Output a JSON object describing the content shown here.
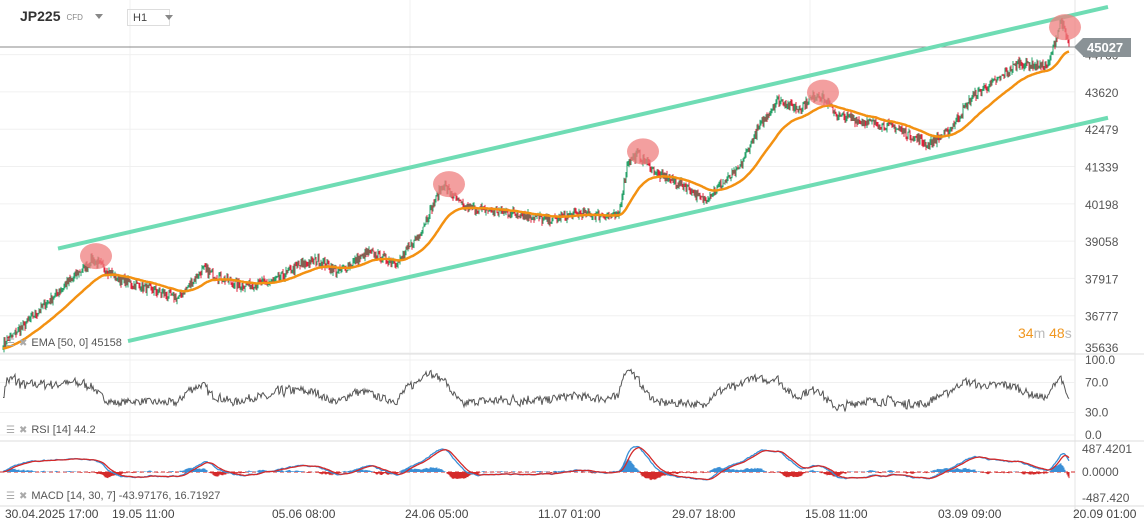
{
  "header": {
    "symbol": "JP225",
    "symbol_type": "CFD",
    "timeframe": "H1"
  },
  "current_price_label": "45027",
  "countdown": {
    "minutes": "34",
    "m": "m",
    "seconds": "48",
    "s": "s"
  },
  "indicators": {
    "ema": "EMA [50, 0] 45158",
    "rsi": "RSI [14] 44.2",
    "macd": "MACD [14, 30, 7] -43.97176, 16.71927"
  },
  "colors": {
    "up": "#26a269",
    "down": "#e0203a",
    "ema": "#f39112",
    "channel": "#6fdcb4",
    "highlight": "#ef7f7f",
    "rsi": "#555555",
    "macd": "#3a8fd6",
    "signal": "#d42a2a"
  },
  "chart_data": {
    "type": "candlestick",
    "price_axis": {
      "ticks": [
        "44760",
        "43620",
        "42479",
        "41339",
        "40198",
        "39058",
        "37917",
        "36777",
        "35636"
      ],
      "range": [
        35636,
        45900
      ]
    },
    "rsi_axis": {
      "ticks": [
        "100.0",
        "70.0",
        "30.0",
        "0.0"
      ]
    },
    "macd_axis": {
      "ticks": [
        "487.4201",
        "0.0000",
        "-487.420"
      ]
    },
    "time_labels": [
      "30.04.2025  17:00",
      "19.05  11:00",
      "05.06  08:00",
      "24.06  05:00",
      "11.07  01:00",
      "29.07  18:00",
      "15.08  11:00",
      "03.09  09:00",
      "20.09  01:00"
    ],
    "close_path": [
      [
        0,
        35900
      ],
      [
        35,
        36900
      ],
      [
        55,
        37500
      ],
      [
        90,
        38500
      ],
      [
        115,
        37900
      ],
      [
        145,
        37600
      ],
      [
        175,
        37300
      ],
      [
        200,
        38200
      ],
      [
        235,
        37700
      ],
      [
        270,
        37800
      ],
      [
        295,
        38300
      ],
      [
        315,
        38500
      ],
      [
        335,
        38100
      ],
      [
        365,
        38700
      ],
      [
        395,
        38400
      ],
      [
        415,
        39200
      ],
      [
        440,
        40800
      ],
      [
        460,
        40100
      ],
      [
        485,
        40000
      ],
      [
        515,
        39900
      ],
      [
        545,
        39700
      ],
      [
        575,
        39900
      ],
      [
        615,
        39800
      ],
      [
        625,
        41500
      ],
      [
        635,
        41700
      ],
      [
        655,
        41100
      ],
      [
        685,
        40700
      ],
      [
        700,
        40300
      ],
      [
        715,
        40700
      ],
      [
        735,
        41200
      ],
      [
        755,
        42500
      ],
      [
        775,
        43400
      ],
      [
        795,
        43100
      ],
      [
        815,
        43600
      ],
      [
        835,
        42900
      ],
      [
        865,
        42700
      ],
      [
        895,
        42500
      ],
      [
        925,
        42000
      ],
      [
        945,
        42400
      ],
      [
        970,
        43500
      ],
      [
        995,
        44000
      ],
      [
        1015,
        44500
      ],
      [
        1045,
        44400
      ],
      [
        1058,
        45800
      ],
      [
        1066,
        45027
      ]
    ],
    "channel": {
      "upper": [
        [
          55,
          38830
        ],
        [
          1105,
          46220
        ]
      ],
      "lower": [
        [
          125,
          36000
        ],
        [
          1105,
          42830
        ]
      ]
    },
    "highlighted_peaks": [
      [
        93,
        38600
      ],
      [
        446,
        40800
      ],
      [
        640,
        41800
      ],
      [
        820,
        43600
      ],
      [
        1062,
        45600
      ]
    ]
  }
}
